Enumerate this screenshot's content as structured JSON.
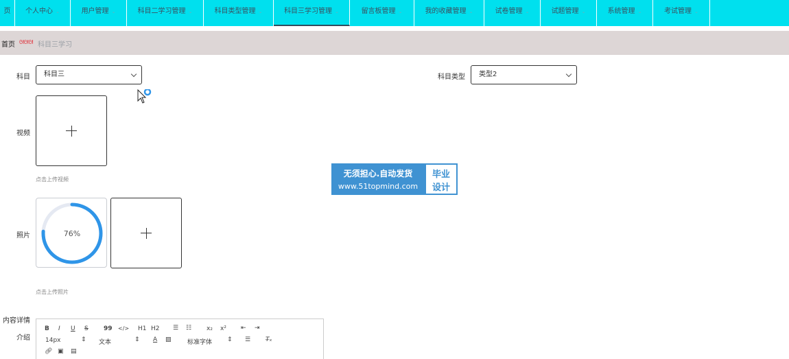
{
  "top_strip_text": "",
  "nav": {
    "items": [
      {
        "label": "页"
      },
      {
        "label": "个人中心"
      },
      {
        "label": "用户管理"
      },
      {
        "label": "科目二学习管理"
      },
      {
        "label": "科目类型管理"
      },
      {
        "label": "科目三学习管理"
      },
      {
        "label": "留言板管理"
      },
      {
        "label": "我的收藏管理"
      },
      {
        "label": "试卷管理"
      },
      {
        "label": "试题管理"
      },
      {
        "label": "系统管理"
      },
      {
        "label": "考试管理"
      }
    ],
    "active_index": 5,
    "chevron": "⌄"
  },
  "breadcrumb": {
    "home": "首页",
    "separator": "ᘛᘛᘛ",
    "current": "科目三学习"
  },
  "form": {
    "subject": {
      "label": "科目",
      "value": "科目三"
    },
    "subject_type": {
      "label": "科目类型",
      "value": "类型2"
    },
    "video": {
      "label": "视频",
      "hint": "点击上传视频"
    },
    "photo": {
      "label": "照片",
      "hint": "点击上传照片",
      "progress_text": "76%",
      "progress": 0.76
    },
    "content": {
      "label": "内容详情"
    },
    "intro": {
      "label": "介绍"
    }
  },
  "editor": {
    "toolbar_row1": [
      "B",
      "I",
      "U",
      "S",
      "99",
      "</>",
      "H1",
      "H2",
      "☰",
      "☷",
      "x₂",
      "x²",
      "⇤",
      "⇥"
    ],
    "font_size": "14px",
    "text_style": "文本",
    "font_family": "标准字体"
  },
  "watermark": {
    "line1": "无须担心.自动发货",
    "line2": "www.51topmind.com",
    "right1": "毕业",
    "right2": "设计"
  },
  "colors": {
    "nav_bg": "#00e0ee",
    "breadcrumb_bg": "#ddd6d6",
    "progress": "#2f95e8",
    "watermark": "#3f92d2"
  }
}
